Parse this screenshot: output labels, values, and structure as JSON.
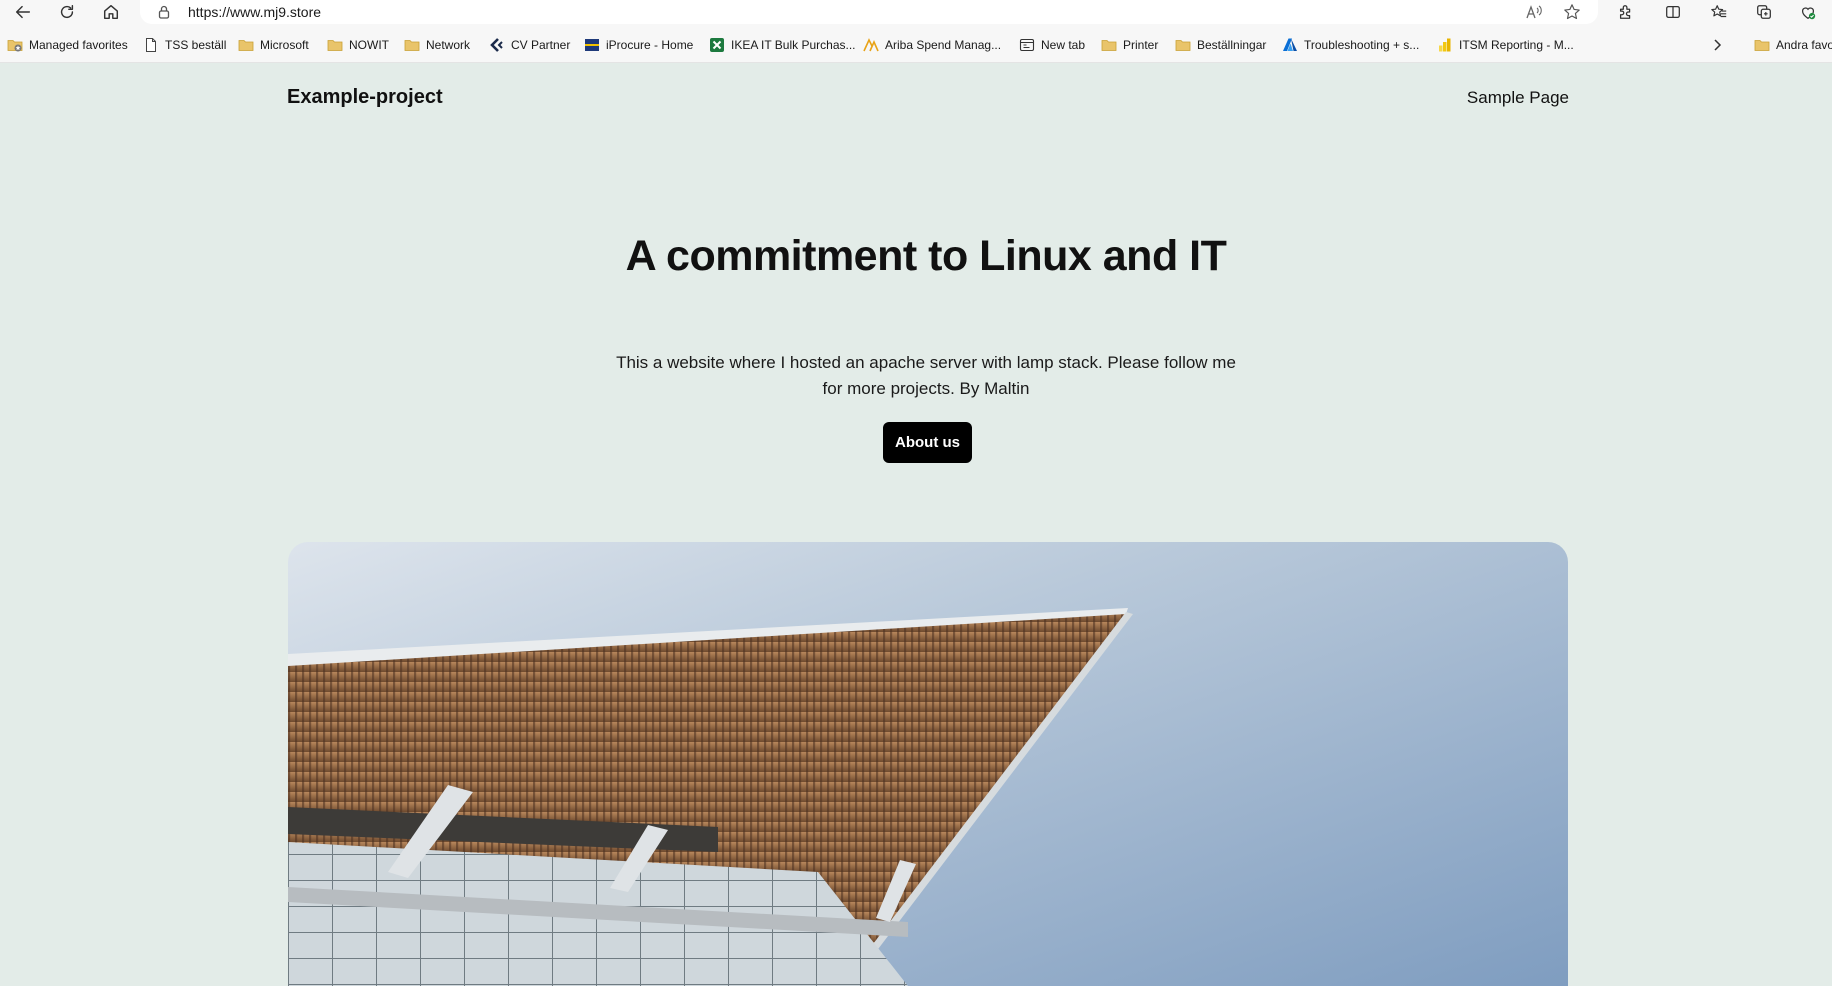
{
  "browser": {
    "url": "https://www.mj9.store",
    "toolbar_icons": [
      "back-arrow-icon",
      "refresh-icon",
      "home-icon",
      "lock-icon",
      "read-aloud-icon",
      "favorite-star-icon",
      "extensions-icon",
      "split-screen-icon",
      "favorites-icon",
      "collections-icon",
      "browser-essentials-icon"
    ],
    "favorites": [
      {
        "label": "Managed favorites",
        "icon": "folder-icon"
      },
      {
        "label": "TSS beställ",
        "icon": "page-icon"
      },
      {
        "label": "Microsoft",
        "icon": "folder-icon"
      },
      {
        "label": "NOWIT",
        "icon": "folder-icon"
      },
      {
        "label": "Network",
        "icon": "folder-icon"
      },
      {
        "label": "CV Partner",
        "icon": "cv-partner-icon"
      },
      {
        "label": "iProcure - Home",
        "icon": "iprocure-icon"
      },
      {
        "label": "IKEA IT Bulk Purchas...",
        "icon": "excel-icon"
      },
      {
        "label": "Ariba Spend Manag...",
        "icon": "ariba-icon"
      },
      {
        "label": "New tab",
        "icon": "new-tab-icon"
      },
      {
        "label": "Printer",
        "icon": "folder-icon"
      },
      {
        "label": "Beställningar",
        "icon": "folder-icon"
      },
      {
        "label": "Troubleshooting + s...",
        "icon": "azure-icon"
      },
      {
        "label": "ITSM Reporting - M...",
        "icon": "power-bi-icon"
      }
    ],
    "more_favorites_icon": "chevron-right-icon",
    "other_favorites": {
      "label": "Andra favo",
      "icon": "folder-icon"
    }
  },
  "site": {
    "title": "Example-project",
    "nav": [
      "Sample Page"
    ]
  },
  "hero": {
    "heading": "A commitment to Linux and IT",
    "subtext": "This a website where I hosted an apache server with lamp stack. Please follow me for more projects. By Maltin",
    "button": "About us"
  },
  "image": {
    "subject": "building-canopy-photo"
  },
  "colors": {
    "page_background": "#e3ece8",
    "button_background": "#000000",
    "button_text": "#ffffff",
    "sky": "#8fa8c6",
    "canopy_wood": "#a0724c"
  }
}
